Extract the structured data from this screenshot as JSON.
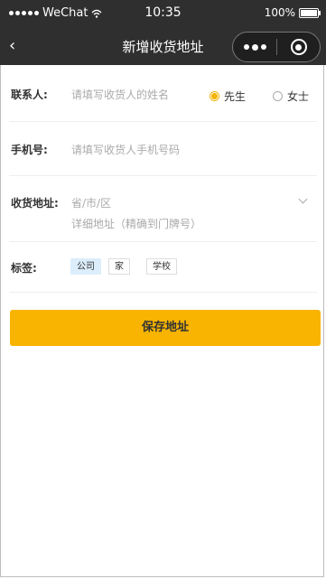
{
  "status_bar": {
    "carrier": "WeChat",
    "time": "10:35",
    "battery": "100%"
  },
  "nav": {
    "back_icon": "‹",
    "title": "新增收货地址"
  },
  "form": {
    "contact": {
      "label": "联系人:",
      "placeholder": "请填写收货人的姓名",
      "options": [
        "先生",
        "女士"
      ],
      "selected": "先生"
    },
    "phone": {
      "label": "手机号:",
      "placeholder": "请填写收货人手机号码"
    },
    "address": {
      "label": "收货地址:",
      "region_placeholder": "省/市/区",
      "detail_placeholder": "详细地址（精确到门牌号）"
    },
    "tags": {
      "label": "标签:",
      "items": [
        "公司",
        "家",
        "学校"
      ],
      "selected": "公司"
    }
  },
  "save_button": "保存地址",
  "colors": {
    "accent": "#f8b400",
    "nav_bg": "#2f2f2f",
    "tag_active": "#dceefb"
  },
  "icons": [
    "signal-icon",
    "wifi-icon",
    "battery-icon",
    "back-icon",
    "more-icon",
    "close-mini-program-icon",
    "chevron-down-icon"
  ]
}
